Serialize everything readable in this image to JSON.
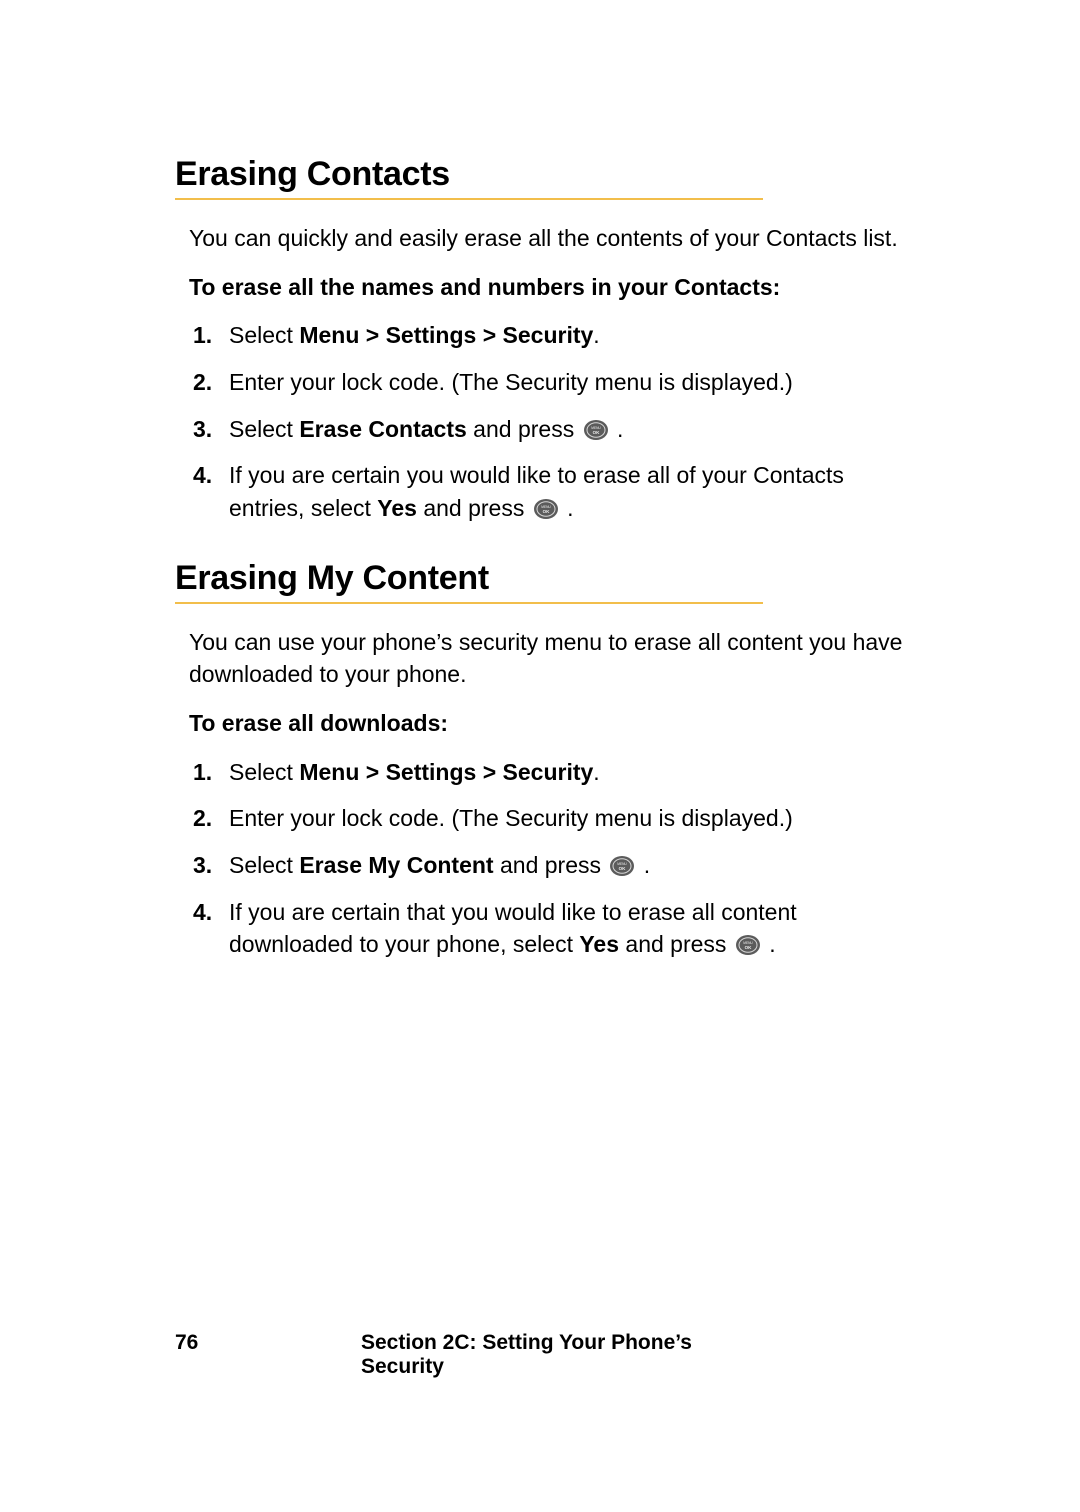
{
  "sections": [
    {
      "title": "Erasing Contacts",
      "intro": "You can quickly and easily erase all the contents of your Contacts list.",
      "lead": "To erase all the names and numbers in your Contacts:",
      "steps": [
        {
          "pre": "Select ",
          "bold": "Menu > Settings > Security",
          "post": "."
        },
        {
          "pre": "Enter your lock code. (The Security menu is displayed.)"
        },
        {
          "pre": "Select ",
          "bold": "Erase Contacts",
          "post": " and press ",
          "ok": true,
          "tail": " ."
        },
        {
          "pre": "If you are certain you would like to erase all of your Contacts entries, select ",
          "bold": "Yes",
          "post": " and press ",
          "ok": true,
          "tail": " ."
        }
      ]
    },
    {
      "title": "Erasing My Content",
      "intro": "You can use your phone’s security menu to erase all content you have downloaded to your phone.",
      "lead": "To erase all downloads:",
      "steps": [
        {
          "pre": "Select ",
          "bold": "Menu > Settings > Security",
          "post": "."
        },
        {
          "pre": "Enter your lock code. (The Security menu is displayed.)"
        },
        {
          "pre": "Select ",
          "bold": "Erase My Content",
          "post": " and press ",
          "ok": true,
          "tail": " ."
        },
        {
          "pre": "If you are certain that you would like to erase all content downloaded to your phone, select ",
          "bold": "Yes",
          "post": " and press ",
          "ok": true,
          "tail": " ."
        }
      ]
    }
  ],
  "footer": {
    "page": "76",
    "section": "Section 2C: Setting Your Phone’s Security"
  }
}
